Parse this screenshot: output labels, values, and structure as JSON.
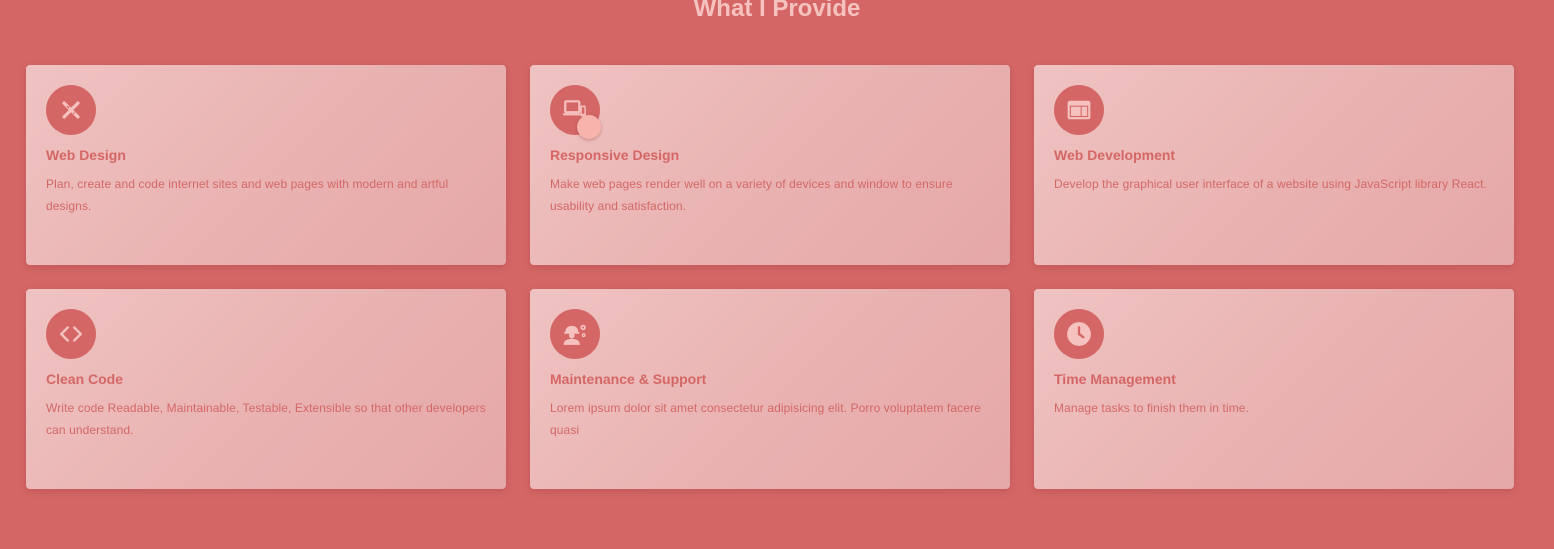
{
  "section": {
    "title": "What I Provide"
  },
  "colors": {
    "background": "#d46766",
    "accent": "#d46766",
    "icon_fill": "#f6c2bf",
    "cursor": "#f7b3ac"
  },
  "cards": [
    {
      "title": "Web Design",
      "description": "Plan, create and code internet sites and web pages with modern and artful designs.",
      "icon": "design-tools-icon"
    },
    {
      "title": "Responsive Design",
      "description": "Make web pages render well on a variety of devices and window to ensure usability and satisfaction.",
      "icon": "devices-icon"
    },
    {
      "title": "Web Development",
      "description": "Develop the graphical user interface of a website using JavaScript library React.",
      "icon": "web-window-icon"
    },
    {
      "title": "Clean Code",
      "description": "Write code Readable, Maintainable, Testable, Extensible so that other developers can understand.",
      "icon": "code-icon"
    },
    {
      "title": "Maintenance & Support",
      "description": "Lorem ipsum dolor sit amet consectetur adipisicing elit. Porro voluptatem facere quasi",
      "icon": "engineer-icon"
    },
    {
      "title": "Time Management",
      "description": "Manage tasks to finish them in time.",
      "icon": "clock-icon"
    }
  ]
}
